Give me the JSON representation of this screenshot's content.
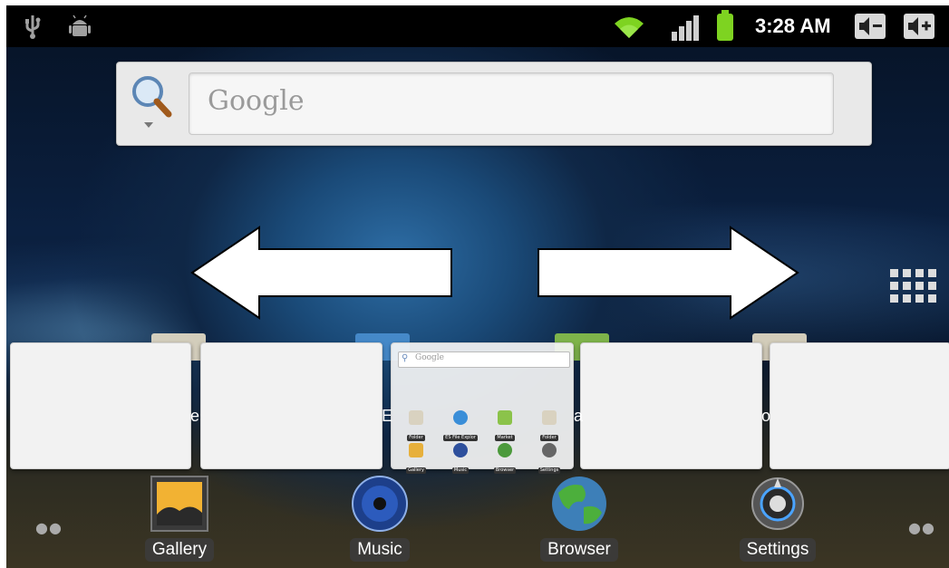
{
  "status_bar": {
    "left_icons": [
      "usb-icon",
      "android-debug-icon"
    ],
    "right_icons": [
      "wifi-icon",
      "signal-icon",
      "battery-icon"
    ],
    "time": "3:28 AM",
    "buttons": [
      {
        "name": "volume-down-button",
        "icon": "volume-down-icon"
      },
      {
        "name": "volume-up-button",
        "icon": "volume-up-icon"
      }
    ]
  },
  "search": {
    "placeholder": "Google",
    "icon": "search-icon"
  },
  "navigation": {
    "left_arrow": "arrow-left-icon",
    "right_arrow": "arrow-right-icon",
    "app_drawer": "app-drawer-grid-icon"
  },
  "workspace_preview": {
    "screens": 5,
    "current_index": 2,
    "mini_search_placeholder": "Google",
    "mini_apps": [
      {
        "label": "Folder",
        "color": "#d9d2c0"
      },
      {
        "label": "ES File Explor",
        "color": "#3a8ed8"
      },
      {
        "label": "Market",
        "color": "#8bc34a"
      },
      {
        "label": "Folder",
        "color": "#d9d2c0"
      },
      {
        "label": "Gallery",
        "color": "#e7b03c"
      },
      {
        "label": "Music",
        "color": "#2d4f9c"
      },
      {
        "label": "Browser",
        "color": "#4c9a3c"
      },
      {
        "label": "Settings",
        "color": "#666666"
      }
    ]
  },
  "edge_letters": [
    "e",
    "E",
    "a",
    "o"
  ],
  "dock": [
    {
      "label": "Gallery",
      "icon": "gallery-icon"
    },
    {
      "label": "Music",
      "icon": "music-icon"
    },
    {
      "label": "Browser",
      "icon": "browser-globe-icon"
    },
    {
      "label": "Settings",
      "icon": "settings-icon"
    }
  ],
  "colors": {
    "status_bar": "#000000",
    "battery": "#7ed321",
    "wifi": "#7ed321"
  }
}
